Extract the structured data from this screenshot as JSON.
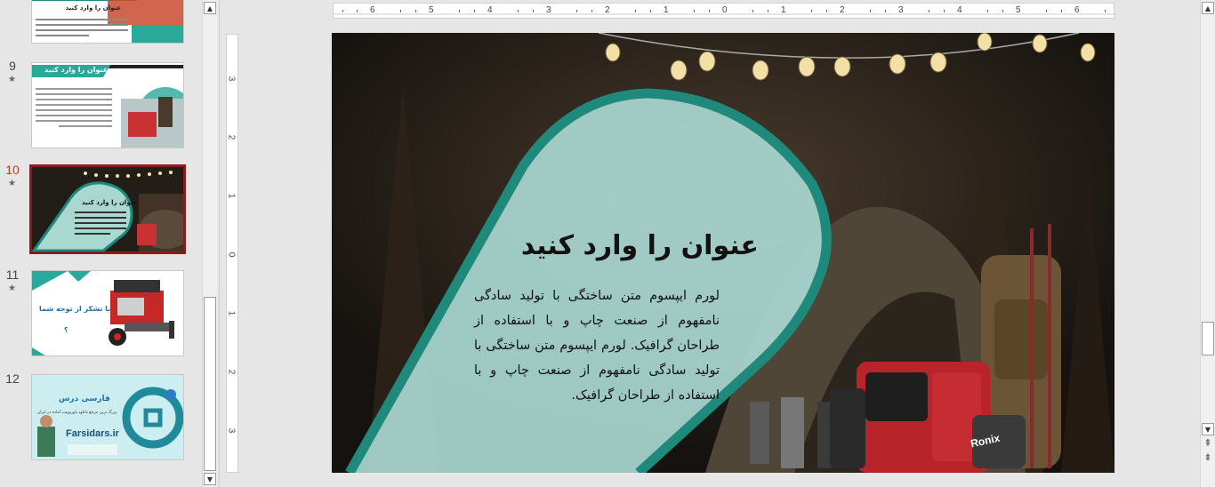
{
  "thumbnails": [
    {
      "number": "",
      "star": "",
      "title": "عنوان را وارد کنید"
    },
    {
      "number": "9",
      "star": "★",
      "title": "عنوان را وارد کنید"
    },
    {
      "number": "10",
      "star": "★",
      "title": "عنوان را وارد کنید"
    },
    {
      "number": "11",
      "star": "★",
      "title": "با تشکر از توجه شما",
      "subtitle": "؟"
    },
    {
      "number": "12",
      "star": "",
      "brand": "فارسی درس",
      "tagline": "بزرگ ترین مرجع دانلود پاورپوینت آماده در ایران",
      "site": "Farsidars.ir"
    }
  ],
  "ruler": {
    "horizontal": [
      "6",
      "5",
      "4",
      "3",
      "2",
      "1",
      "0",
      "1",
      "2",
      "3",
      "4",
      "5",
      "6"
    ],
    "vertical": [
      "3",
      "2",
      "1",
      "0",
      "1",
      "2",
      "3"
    ]
  },
  "slide": {
    "title": "عنوان را وارد کنید",
    "body": "لورم ایپسوم متن ساختگی با تولید سادگی نامفهوم از صنعت چاپ و با استفاده از طراحان گرافیک. لورم ایپسوم متن ساختگی با تولید سادگی نامفهوم از صنعت چاپ و با استفاده از طراحان گرافیک.",
    "generator_brand": "Ronix"
  },
  "colors": {
    "teal": "#1f8a7b",
    "shape_fill": "#a9d8d1",
    "selected_border": "#8c1c1c",
    "active_number": "#c43e1c"
  },
  "icons": {
    "scroll_up": "▲",
    "scroll_down": "▼",
    "prev_slide": "⇞",
    "next_slide": "⇟"
  }
}
